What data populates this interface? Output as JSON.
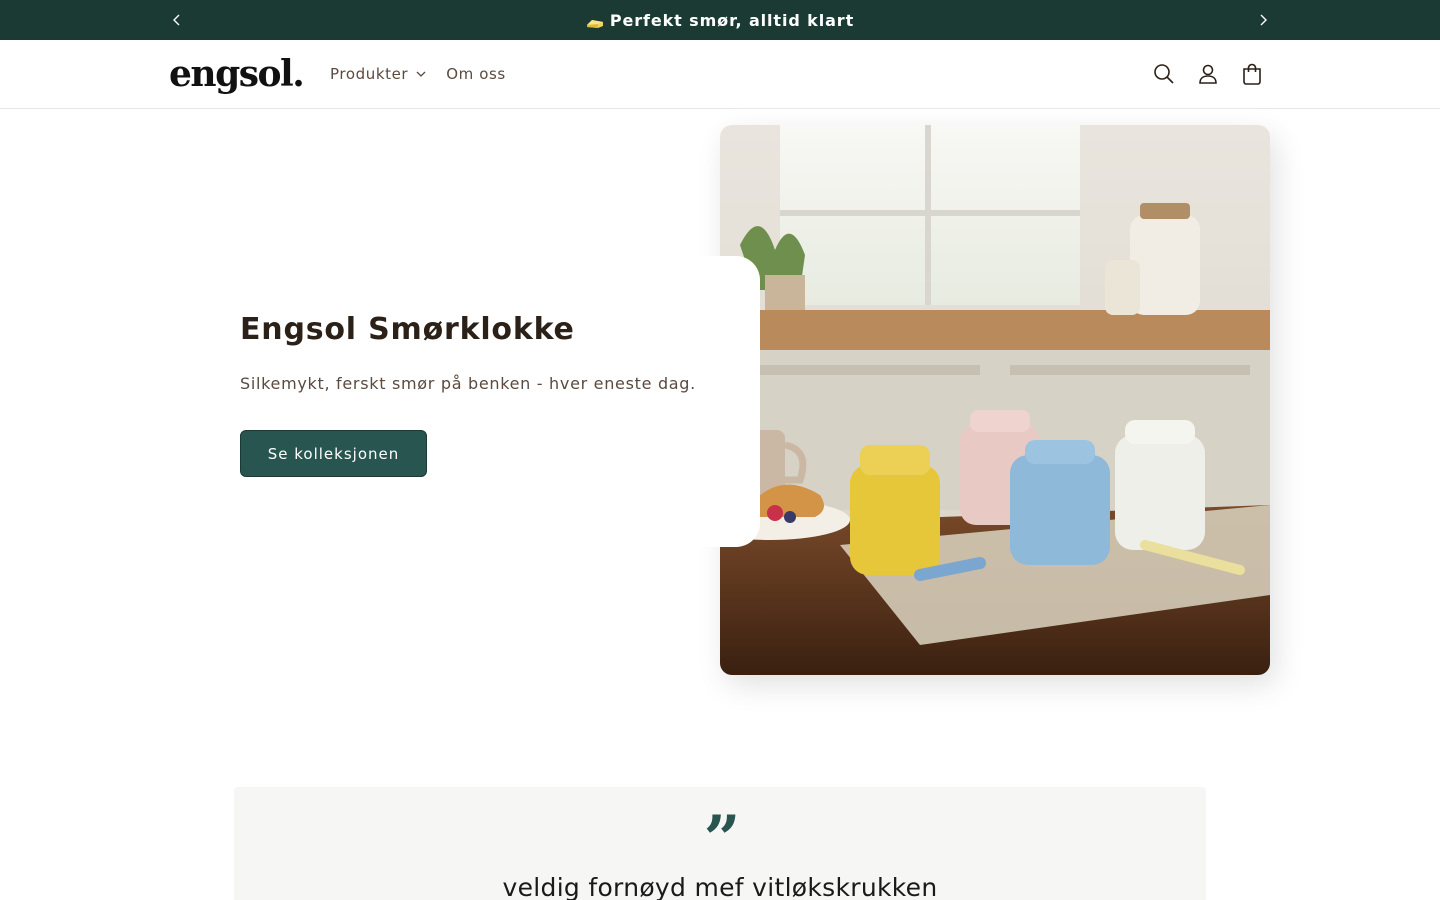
{
  "announcement": {
    "icon": "butter-icon",
    "text": "Perfekt smør, alltid klart",
    "prev_icon": "chevron-left-icon",
    "next_icon": "chevron-right-icon"
  },
  "header": {
    "logo": "engsol.",
    "nav": [
      {
        "label": "Produkter",
        "has_dropdown": true
      },
      {
        "label": "Om oss",
        "has_dropdown": false
      }
    ],
    "icons": [
      "search-icon",
      "account-icon",
      "cart-icon"
    ]
  },
  "hero": {
    "title": "Engsol Smørklokke",
    "subtitle": "Silkemykt, ferskt smør på benken - hver eneste dag.",
    "cta_label": "Se kolleksjonen",
    "image_subject": "butter-bells-on-kitchen-counter"
  },
  "testimonial": {
    "quote_mark": "”",
    "text": "veldig fornøyd mef vitløkskrukken"
  },
  "colors": {
    "announcement_bg": "#1b3a34",
    "button_bg": "#285550",
    "text_dark": "#2b2118",
    "text_muted": "#5a4a3f",
    "testimonial_bg": "#f6f6f4"
  }
}
